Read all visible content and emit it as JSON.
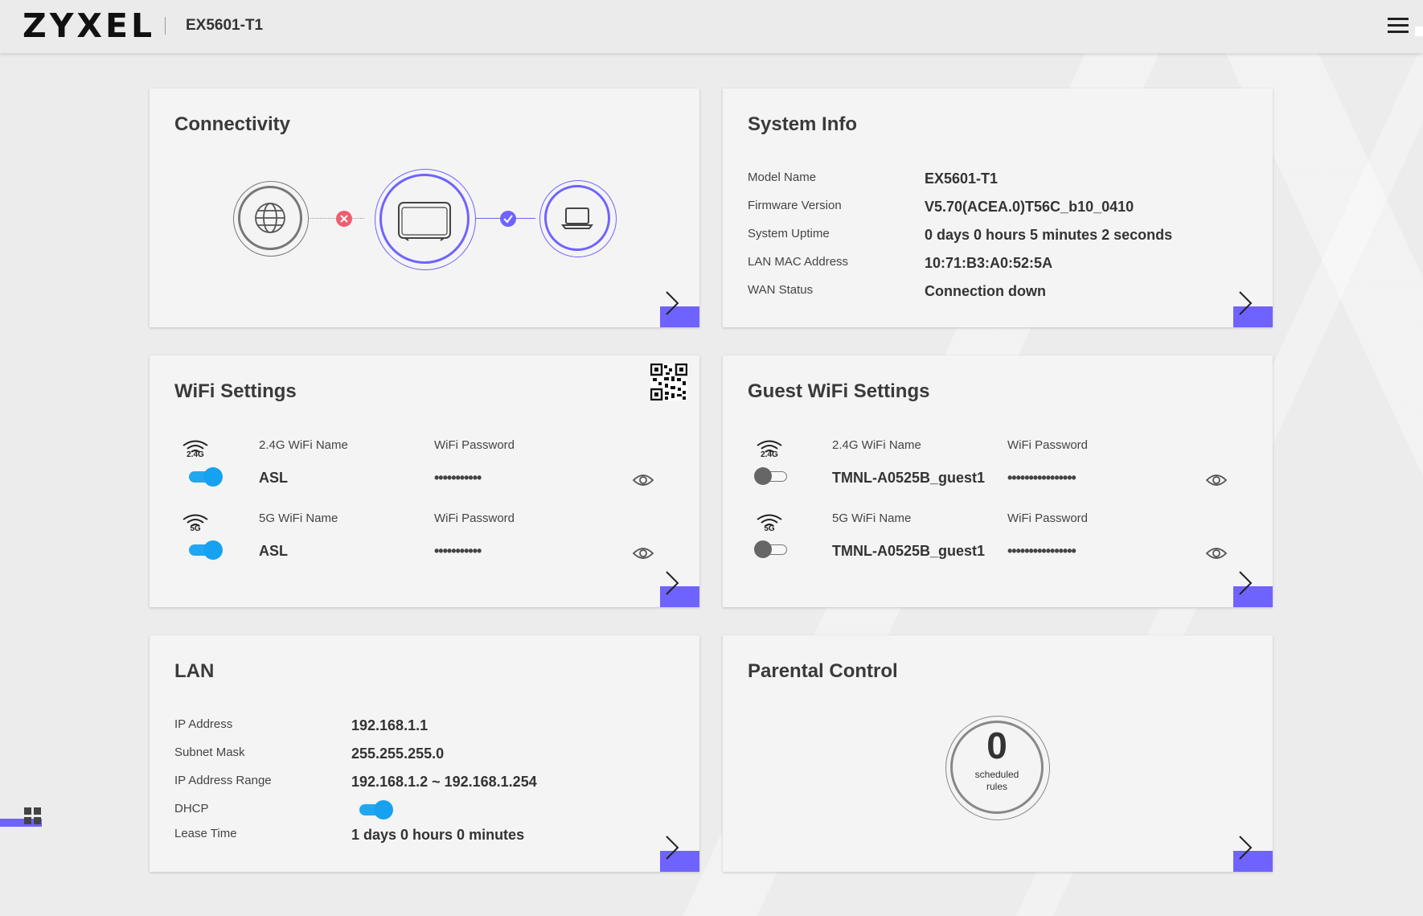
{
  "header": {
    "logo": "ZYXEL",
    "model": "EX5601-T1"
  },
  "connectivity": {
    "title": "Connectivity",
    "internet_status": "down",
    "lan_status": "up",
    "colors": {
      "error": "#ef5d6e",
      "ok": "#6f63ff",
      "accent": "#6f63ff"
    }
  },
  "system_info": {
    "title": "System Info",
    "rows": [
      {
        "label": "Model Name",
        "value": "EX5601-T1"
      },
      {
        "label": "Firmware Version",
        "value": "V5.70(ACEA.0)T56C_b10_0410"
      },
      {
        "label": "System Uptime",
        "value": "0 days 0 hours 5 minutes 2 seconds"
      },
      {
        "label": "LAN MAC Address",
        "value": "10:71:B3:A0:52:5A"
      },
      {
        "label": "WAN Status",
        "value": "Connection down"
      }
    ]
  },
  "wifi": {
    "title": "WiFi Settings",
    "bands": [
      {
        "band": "2.4G",
        "name_label": "2.4G WiFi Name",
        "password_label": "WiFi Password",
        "ssid": "ASL",
        "password_mask": "•••••••••••",
        "enabled": true
      },
      {
        "band": "5G",
        "name_label": "5G WiFi Name",
        "password_label": "WiFi Password",
        "ssid": "ASL",
        "password_mask": "•••••••••••",
        "enabled": true
      }
    ]
  },
  "guest_wifi": {
    "title": "Guest WiFi Settings",
    "bands": [
      {
        "band": "2.4G",
        "name_label": "2.4G WiFi Name",
        "password_label": "WiFi Password",
        "ssid": "TMNL-A0525B_guest1",
        "password_mask": "••••••••••••••••",
        "enabled": false
      },
      {
        "band": "5G",
        "name_label": "5G WiFi Name",
        "password_label": "WiFi Password",
        "ssid": "TMNL-A0525B_guest1",
        "password_mask": "••••••••••••••••",
        "enabled": false
      }
    ]
  },
  "lan": {
    "title": "LAN",
    "ip_label": "IP Address",
    "ip_value": "192.168.1.1",
    "mask_label": "Subnet Mask",
    "mask_value": "255.255.255.0",
    "range_label": "IP Address Range",
    "range_value": "192.168.1.2 ~ 192.168.1.254",
    "dhcp_label": "DHCP",
    "dhcp_enabled": true,
    "lease_label": "Lease Time",
    "lease_value": "1 days 0 hours 0 minutes"
  },
  "parental": {
    "title": "Parental Control",
    "count": "0",
    "caption_line1": "scheduled",
    "caption_line2": "rules"
  }
}
